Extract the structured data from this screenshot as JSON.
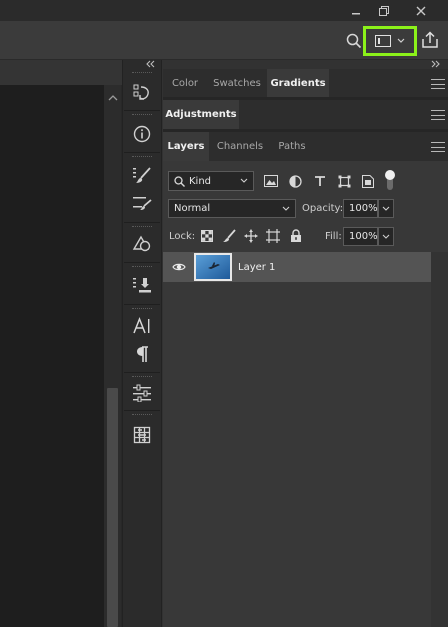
{
  "window": {
    "minimize_icon": "minimize-icon",
    "restore_icon": "restore-icon",
    "close_icon": "close-icon"
  },
  "options_bar": {
    "search_icon": "search-icon",
    "workspace_icon": "workspace-icon",
    "share_icon": "share-icon",
    "highlight_color": "#8cf21a"
  },
  "panel_groups": {
    "top": {
      "tabs": [
        {
          "label": "Color",
          "active": false
        },
        {
          "label": "Swatches",
          "active": false
        },
        {
          "label": "Gradients",
          "active": true
        }
      ]
    },
    "middle": {
      "tabs": [
        {
          "label": "Adjustments",
          "active": true
        }
      ]
    },
    "layers": {
      "tabs": [
        {
          "label": "Layers",
          "active": true
        },
        {
          "label": "Channels",
          "active": false
        },
        {
          "label": "Paths",
          "active": false
        }
      ],
      "filter_kind": "Kind",
      "blend_mode": "Normal",
      "opacity_label": "Opacity:",
      "opacity_value": "100%",
      "lock_label": "Lock:",
      "fill_label": "Fill:",
      "fill_value": "100%",
      "layer_rows": [
        {
          "name": "Layer 1",
          "visible": true,
          "selected": true
        }
      ]
    }
  }
}
